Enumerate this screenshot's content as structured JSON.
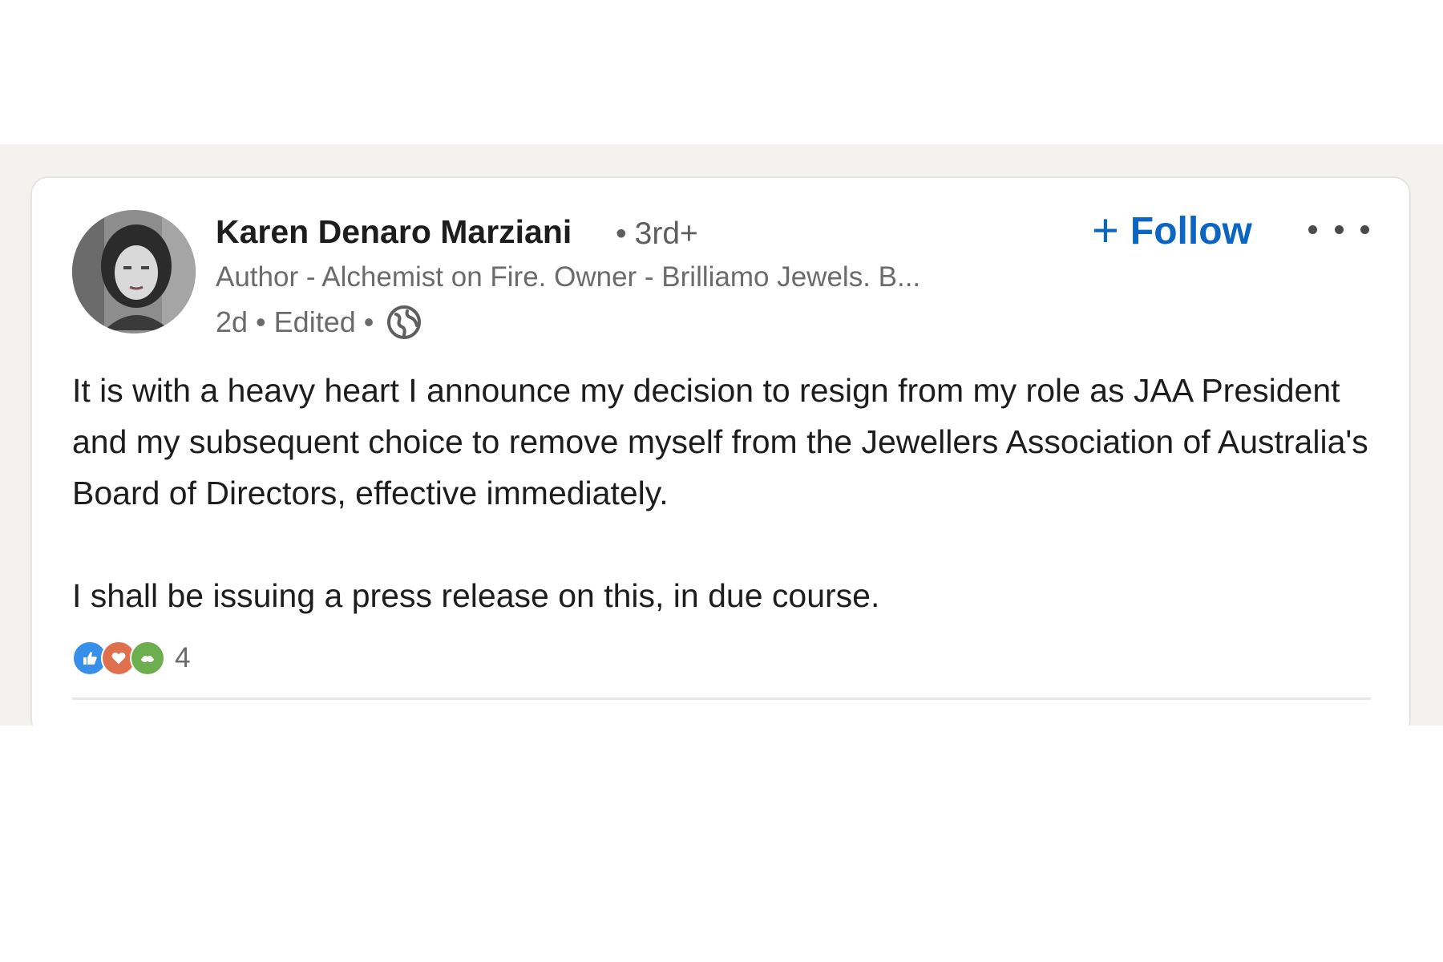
{
  "post": {
    "author": {
      "name": "Karen Denaro Marziani",
      "degree": "3rd+",
      "headline": "Author - Alchemist on Fire. Owner - Brilliamo Jewels. B...",
      "avatar_icon": "profile-photo"
    },
    "meta": {
      "time": "2d",
      "edited": "Edited",
      "visibility_icon": "globe-icon"
    },
    "follow_label": "Follow",
    "more_icon": "ellipsis-icon",
    "body": [
      "It is with a heavy heart I announce my decision to resign from my role as JAA President and my subsequent choice to remove myself from the Jewellers Association of Australia's Board of Directors, effective immediately.",
      "I shall be issuing a press release on this, in due course."
    ],
    "reactions": {
      "icons": [
        "like-icon",
        "love-icon",
        "support-icon"
      ],
      "count": "4"
    }
  },
  "colors": {
    "accent": "#0a66c2",
    "like": "#378fe9",
    "love": "#df704d",
    "support": "#6dae4f",
    "feed_background": "#f3f2ef"
  }
}
